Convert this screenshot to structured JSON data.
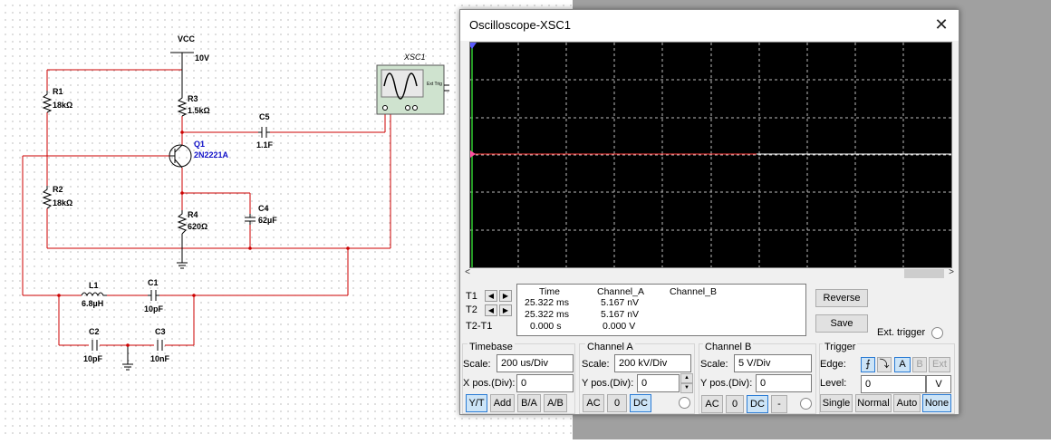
{
  "schematic": {
    "vcc_label": "VCC",
    "vcc_value": "10V",
    "r1_name": "R1",
    "r1_value": "18kΩ",
    "r2_name": "R2",
    "r2_value": "18kΩ",
    "r3_name": "R3",
    "r3_value": "1.5kΩ",
    "r4_name": "R4",
    "r4_value": "620Ω",
    "c1_name": "C1",
    "c1_value": "10pF",
    "c2_name": "C2",
    "c2_value": "10pF",
    "c3_name": "C3",
    "c3_value": "10nF",
    "c4_name": "C4",
    "c4_value": "62µF",
    "c5_name": "C5",
    "c5_value": "1.1F",
    "l1_name": "L1",
    "l1_value": "6.8µH",
    "q1_name": "Q1",
    "q1_value": "2N2221A",
    "scope_name": "XSC1",
    "scope_ext_trig": "Ext Trig",
    "wire_color": "#cc0000"
  },
  "scope": {
    "title": "Oscilloscope-XSC1",
    "close_glyph": "✕",
    "trace_a_color": "#ff4040",
    "trace_b_color": "#ffffff",
    "readout": {
      "t1_label": "T1",
      "t2_label": "T2",
      "t2t1_label": "T2-T1",
      "headers": [
        "Time",
        "Channel_A",
        "Channel_B"
      ],
      "t1": [
        "25.322 ms",
        "5.167 nV",
        ""
      ],
      "t2": [
        "25.322 ms",
        "5.167 nV",
        ""
      ],
      "t2t1": [
        "0.000 s",
        "0.000 V",
        ""
      ]
    },
    "reverse_label": "Reverse",
    "save_label": "Save",
    "ext_trigger_label": "Ext. trigger",
    "timebase": {
      "title": "Timebase",
      "scale_label": "Scale:",
      "scale_value": "200 us/Div",
      "xpos_label": "X pos.(Div):",
      "xpos_value": "0",
      "buttons": [
        "Y/T",
        "Add",
        "B/A",
        "A/B"
      ]
    },
    "channel_a": {
      "title": "Channel A",
      "scale_label": "Scale:",
      "scale_value": "200 kV/Div",
      "ypos_label": "Y pos.(Div):",
      "ypos_value": "0",
      "buttons": [
        "AC",
        "0",
        "DC"
      ]
    },
    "channel_b": {
      "title": "Channel B",
      "scale_label": "Scale:",
      "scale_value": "5  V/Div",
      "ypos_label": "Y pos.(Div):",
      "ypos_value": "0",
      "buttons": [
        "AC",
        "0",
        "DC",
        "-"
      ]
    },
    "trigger": {
      "title": "Trigger",
      "edge_label": "Edge:",
      "edge_rise": "⨍",
      "edge_fall": "⤵",
      "source_buttons": [
        "A",
        "B",
        "Ext"
      ],
      "level_label": "Level:",
      "level_value": "0",
      "level_unit": "V",
      "mode_buttons": [
        "Single",
        "Normal",
        "Auto",
        "None"
      ]
    }
  }
}
